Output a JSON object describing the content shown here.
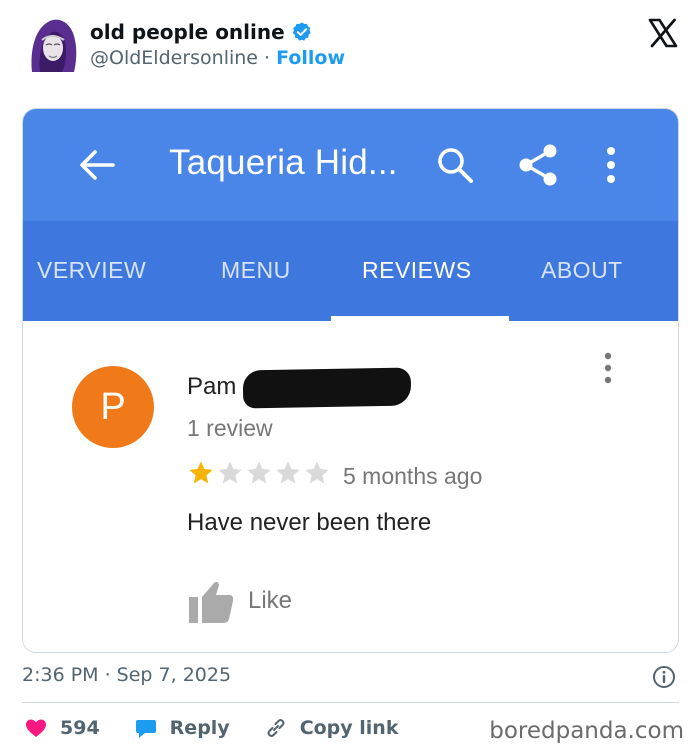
{
  "post": {
    "author_name": "old people online",
    "handle": "@OldEldersonline",
    "separator": "·",
    "follow_label": "Follow",
    "timestamp": "2:36 PM · Sep 7, 2025"
  },
  "screenshot": {
    "title": "Taqueria Hid...",
    "tabs": [
      "VERVIEW",
      "MENU",
      "REVIEWS",
      "ABOUT"
    ],
    "active_tab": "REVIEWS",
    "review": {
      "avatar_letter": "P",
      "reviewer_name": "Pam",
      "review_count": "1 review",
      "rating": 1,
      "rating_max": 5,
      "time_ago": "5 months ago",
      "text": "Have never been there",
      "like_label": "Like"
    }
  },
  "actions": {
    "likes_count": "594",
    "reply_label": "Reply",
    "copy_link_label": "Copy link"
  },
  "watermark": "boredpanda.com",
  "colors": {
    "app_bar": "#4a85e8",
    "tab_bar": "#3e77de",
    "avatar_orange": "#f07a1a",
    "star_gold": "#f4b400",
    "like_heart": "#f91880",
    "reply_blue": "#1d9bf0",
    "follow_blue": "#1d9bf0"
  }
}
